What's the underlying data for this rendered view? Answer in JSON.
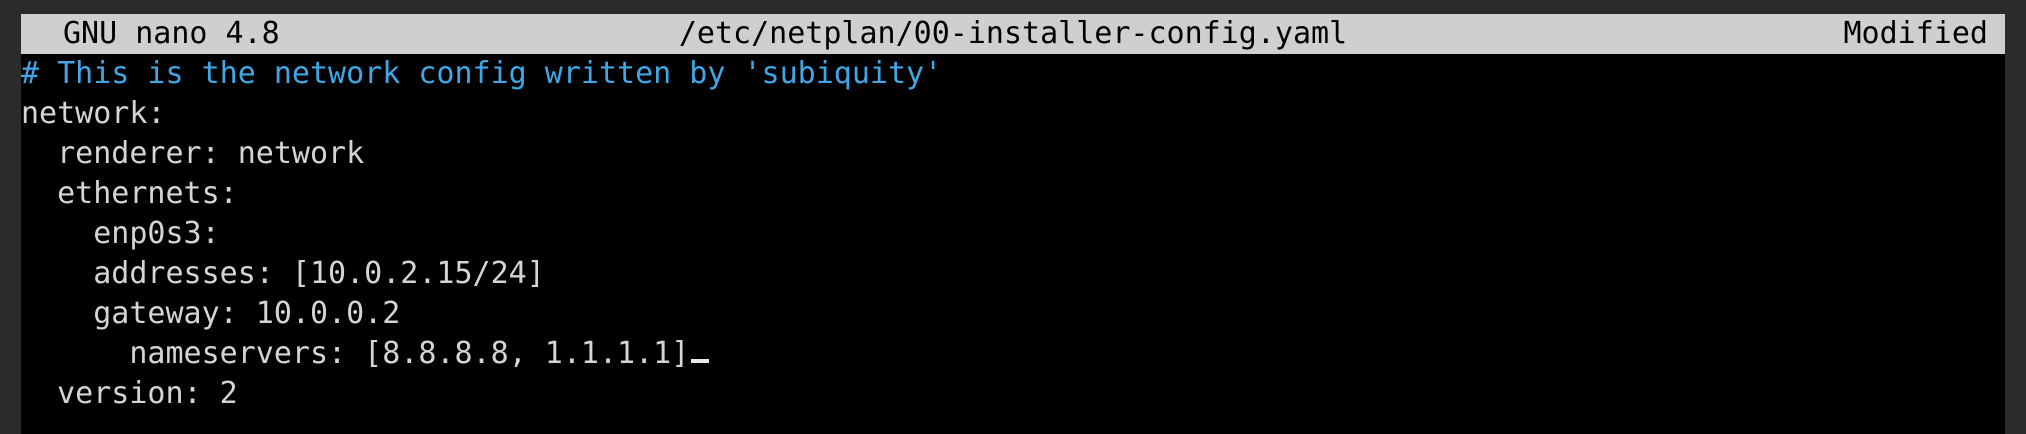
{
  "titlebar": {
    "app": "GNU nano 4.8",
    "filename": "/etc/netplan/00-installer-config.yaml",
    "status": "Modified"
  },
  "editor": {
    "lines": [
      "# This is the network config written by 'subiquity'",
      "network:",
      "  renderer: network",
      "  ethernets:",
      "    enp0s3:",
      "    addresses: [10.0.2.15/24]",
      "    gateway: 10.0.0.2",
      "      nameservers: [8.8.8.8, 1.1.1.1]",
      "  version: 2"
    ]
  },
  "colors": {
    "comment": "#3fa7e6",
    "text": "#d4d4d4",
    "titlebar_bg": "#cfcfcf",
    "background": "#000000"
  }
}
